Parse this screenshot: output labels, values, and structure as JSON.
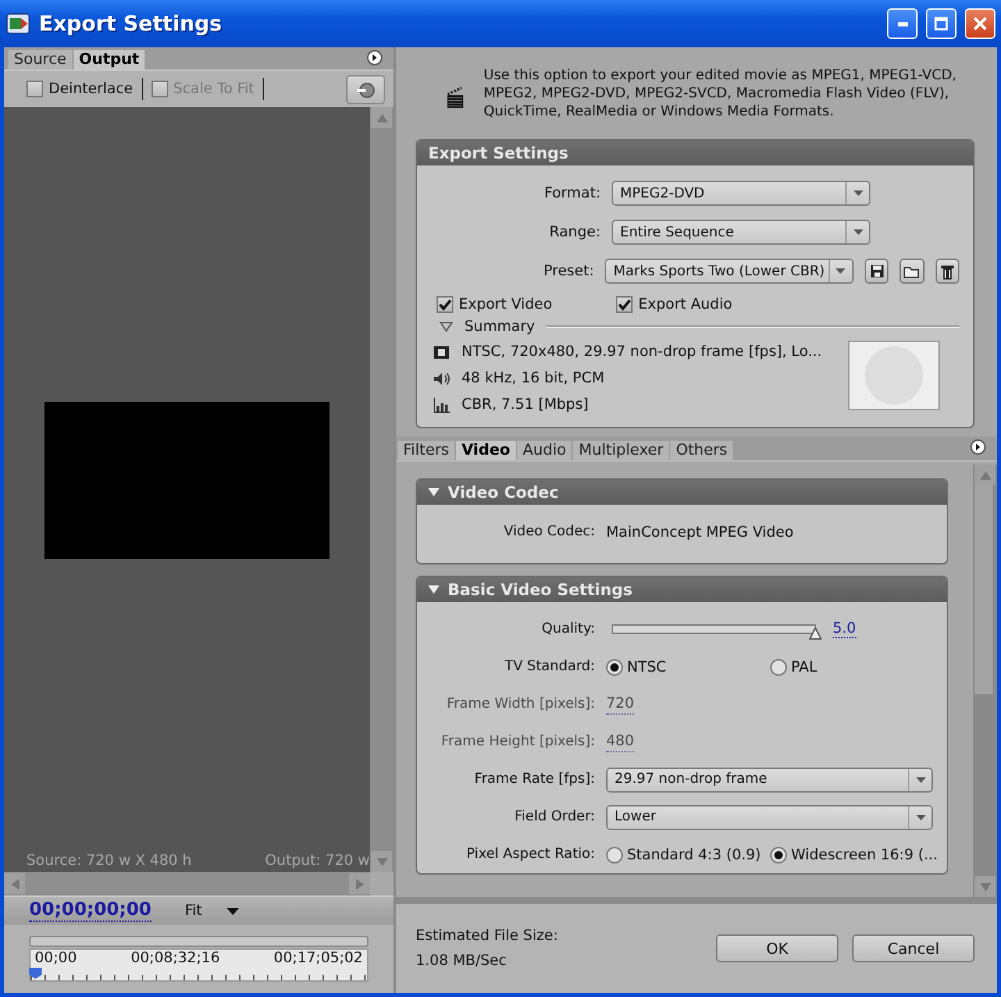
{
  "window": {
    "title": "Export Settings"
  },
  "preview": {
    "tabs": [
      {
        "label": "Source",
        "selected": false
      },
      {
        "label": "Output",
        "selected": true
      }
    ],
    "options": [
      {
        "label": "Deinterlace",
        "checked": false,
        "disabled": false
      },
      {
        "label": "Scale To Fit",
        "checked": false,
        "disabled": true
      }
    ],
    "source_info": "Source: 720 w X 480 h",
    "output_info": "Output: 720 w",
    "timecode": "00;00;00;00",
    "zoom": "Fit",
    "timeline": {
      "ticks": [
        "00;00",
        "00;08;32;16",
        "00;17;05;02"
      ],
      "level": 0
    }
  },
  "description": "Use this option to export your edited movie as MPEG1, MPEG1-VCD, MPEG2, MPEG2-DVD, MPEG2-SVCD, Macromedia Flash Video (FLV), QuickTime, RealMedia or Windows Media Formats.",
  "export_settings": {
    "title": "Export Settings",
    "fields": [
      {
        "label": "Format:",
        "value": "MPEG2-DVD"
      },
      {
        "label": "Range:",
        "value": "Entire Sequence"
      },
      {
        "label": "Preset:",
        "value": "Marks Sports Two (Lower CBR)"
      }
    ],
    "checkboxes": [
      {
        "label": "Export Video",
        "checked": true
      },
      {
        "label": "Export Audio",
        "checked": true
      }
    ],
    "summary": {
      "title": "Summary",
      "expanded": true,
      "lines": [
        {
          "kind": "video",
          "text": "NTSC, 720x480, 29.97 non-drop frame [fps], Lo..."
        },
        {
          "kind": "audio",
          "text": "48 kHz, 16 bit, PCM"
        },
        {
          "kind": "bitrate",
          "text": "CBR, 7.51 [Mbps]"
        }
      ]
    }
  },
  "settings_tabs": [
    {
      "label": "Filters",
      "selected": false
    },
    {
      "label": "Video",
      "selected": true
    },
    {
      "label": "Audio",
      "selected": false
    },
    {
      "label": "Multiplexer",
      "selected": false
    },
    {
      "label": "Others",
      "selected": false
    }
  ],
  "sections": [
    {
      "title": "Video Codec",
      "expanded": true,
      "rows": [
        {
          "kind": "text",
          "label": "Video Codec:",
          "value": "MainConcept MPEG Video"
        }
      ]
    },
    {
      "title": "Basic Video Settings",
      "expanded": true,
      "rows": [
        {
          "kind": "slider",
          "label": "Quality:",
          "level": 1,
          "value": "5.0"
        },
        {
          "kind": "radio",
          "label": "TV Standard:",
          "options": [
            {
              "label": "NTSC",
              "selected": true
            },
            {
              "label": "PAL",
              "selected": false
            }
          ]
        },
        {
          "kind": "readonly",
          "label": "Frame Width [pixels]:",
          "value": "720"
        },
        {
          "kind": "readonly",
          "label": "Frame Height [pixels]:",
          "value": "480"
        },
        {
          "kind": "select",
          "label": "Frame Rate [fps]:",
          "value": "29.97 non-drop frame"
        },
        {
          "kind": "select",
          "label": "Field Order:",
          "value": "Lower"
        },
        {
          "kind": "radio",
          "label": "Pixel Aspect Ratio:",
          "options": [
            {
              "label": "Standard 4:3 (0.9)",
              "selected": false
            },
            {
              "label": "Widescreen 16:9 (...",
              "selected": true
            }
          ]
        }
      ]
    }
  ],
  "estimate": {
    "label": "Estimated File Size:",
    "value": "1.08 MB/Sec"
  },
  "buttons": [
    "OK",
    "Cancel"
  ]
}
